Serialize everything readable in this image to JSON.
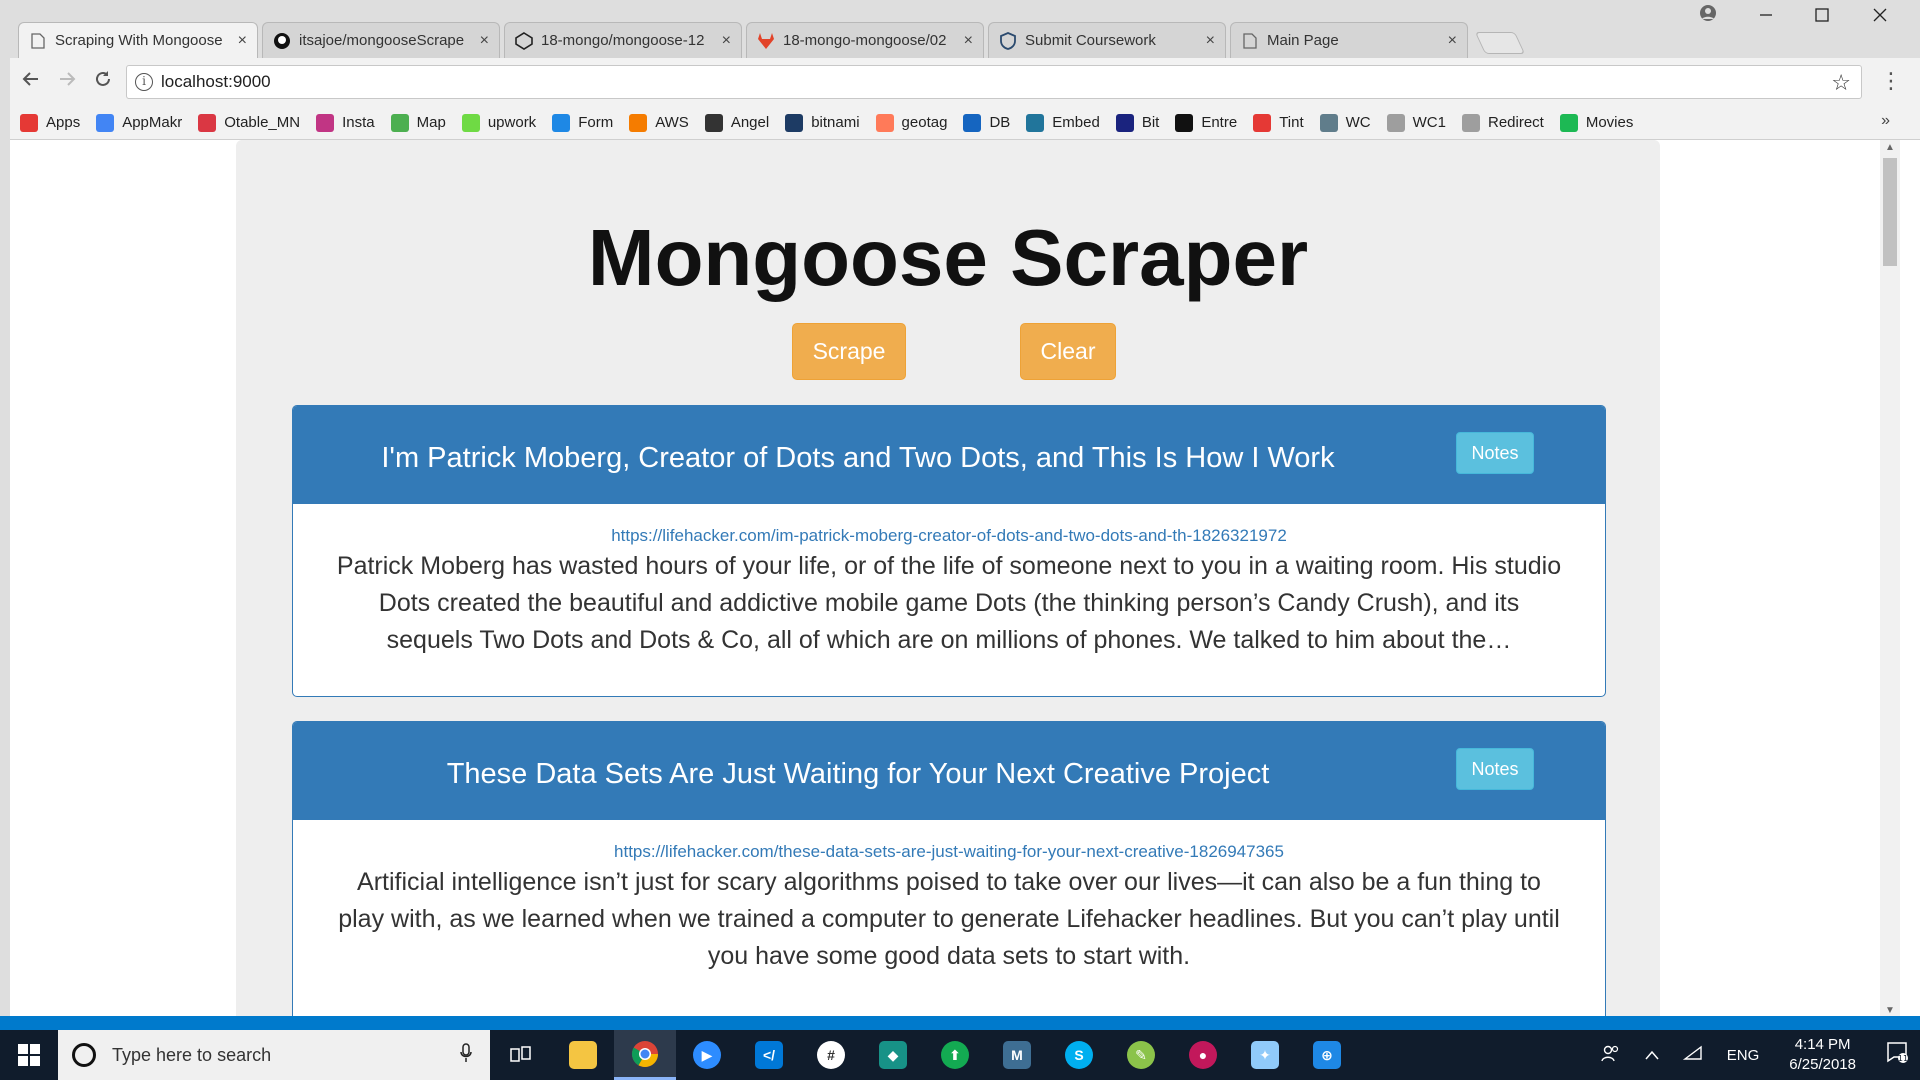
{
  "browser": {
    "tabs": [
      {
        "title": "Scraping With Mongoose",
        "icon": "page-icon",
        "active": true
      },
      {
        "title": "itsajoe/mongooseScrape",
        "icon": "github-icon",
        "active": false
      },
      {
        "title": "18-mongo/mongoose-12",
        "icon": "codepen-icon",
        "active": false
      },
      {
        "title": "18-mongo-mongoose/02",
        "icon": "gitlab-icon",
        "active": false
      },
      {
        "title": "Submit Coursework",
        "icon": "shield-icon",
        "active": false
      },
      {
        "title": "Main Page",
        "icon": "page-icon",
        "active": false
      }
    ],
    "close_glyph": "×",
    "url": "localhost:9000",
    "bookmarks": [
      {
        "label": "Apps",
        "icon": "apps-grid-icon",
        "color": "#e53935"
      },
      {
        "label": "AppMakr",
        "icon": "google-icon",
        "color": "#4285f4"
      },
      {
        "label": "Otable_MN",
        "icon": "opentable-icon",
        "color": "#da3743"
      },
      {
        "label": "Insta",
        "icon": "instagram-icon",
        "color": "#c13584"
      },
      {
        "label": "Map",
        "icon": "map-icon",
        "color": "#4caf50"
      },
      {
        "label": "upwork",
        "icon": "upwork-icon",
        "color": "#6fda44"
      },
      {
        "label": "Form",
        "icon": "form-icon",
        "color": "#1e88e5"
      },
      {
        "label": "AWS",
        "icon": "aws-icon",
        "color": "#f57c00"
      },
      {
        "label": "Angel",
        "icon": "angel-icon",
        "color": "#333333"
      },
      {
        "label": "bitnami",
        "icon": "bitnami-icon",
        "color": "#1d3b64"
      },
      {
        "label": "geotag",
        "icon": "hubspot-icon",
        "color": "#ff7a59"
      },
      {
        "label": "DB",
        "icon": "db-icon",
        "color": "#1565c0"
      },
      {
        "label": "Embed",
        "icon": "wordpress-icon",
        "color": "#21759b"
      },
      {
        "label": "Bit",
        "icon": "bit-icon",
        "color": "#1a237e"
      },
      {
        "label": "Entre",
        "icon": "entre-icon",
        "color": "#111111"
      },
      {
        "label": "Tint",
        "icon": "tint-icon",
        "color": "#e53935"
      },
      {
        "label": "WC",
        "icon": "monitor-icon",
        "color": "#607d8b"
      },
      {
        "label": "WC1",
        "icon": "page-icon",
        "color": "#9e9e9e"
      },
      {
        "label": "Redirect",
        "icon": "page-icon",
        "color": "#9e9e9e"
      },
      {
        "label": "Movies",
        "icon": "play-icon",
        "color": "#1db954"
      }
    ],
    "more_glyph": "»"
  },
  "page": {
    "title": "Mongoose Scraper",
    "scrape_label": "Scrape",
    "clear_label": "Clear",
    "articles": [
      {
        "headline": "I'm Patrick Moberg, Creator of Dots and Two Dots, and This Is How I Work",
        "notes_label": "Notes",
        "link": "https://lifehacker.com/im-patrick-moberg-creator-of-dots-and-two-dots-and-th-1826321972",
        "summary": "Patrick Moberg has wasted hours of your life, or of the life of someone next to you in a waiting room. His studio Dots created the beautiful and addictive mobile game Dots (the thinking person’s Candy Crush), and its sequels Two Dots and Dots & Co, all of which are on millions of phones. We talked to him about the…"
      },
      {
        "headline": "These Data Sets Are Just Waiting for Your Next Creative Project",
        "notes_label": "Notes",
        "link": "https://lifehacker.com/these-data-sets-are-just-waiting-for-your-next-creative-1826947365",
        "summary": "Artificial intelligence isn’t just for scary algorithms poised to take over our lives—it can also be a fun thing to play with, as we learned when we trained a computer to generate Lifehacker headlines. But you can’t play until you have some good data sets to start with."
      }
    ]
  },
  "taskbar": {
    "search_placeholder": "Type here to search",
    "language": "ENG",
    "time": "4:14 PM",
    "date": "6/25/2018",
    "notification_count": "11"
  },
  "colors": {
    "primary": "#337ab7",
    "warning": "#f0ad4e",
    "info": "#5bc0de",
    "container_bg": "#eeeeee"
  }
}
